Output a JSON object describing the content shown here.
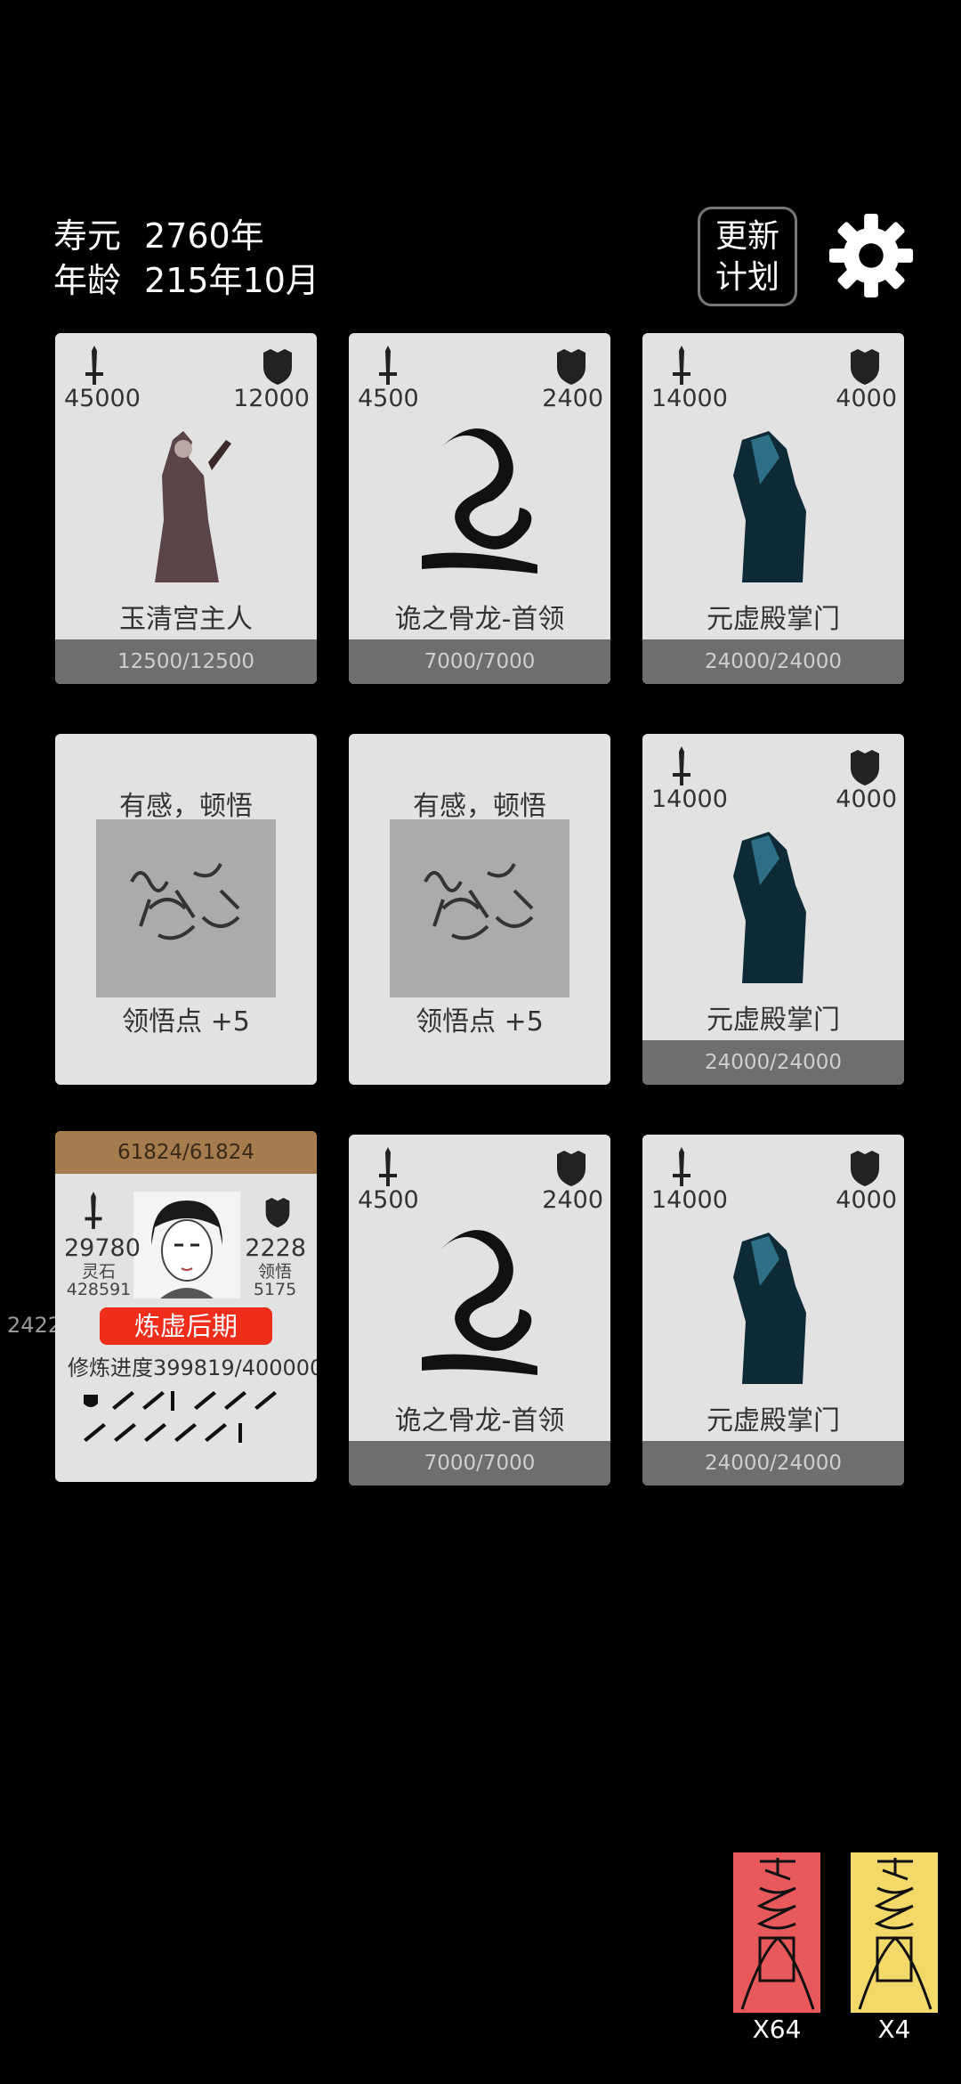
{
  "status": {
    "lifespan_label": "寿元",
    "lifespan_value": "2760年",
    "age_label": "年龄",
    "age_value": "215年10月"
  },
  "update_button": {
    "line1": "更新",
    "line2": "计划"
  },
  "icons": {
    "settings": "gear-icon",
    "attack": "sword-icon",
    "defense": "shield-icon"
  },
  "cards": [
    {
      "atk": "45000",
      "def": "12000",
      "name": "玉清宫主人",
      "hp": "12500/12500"
    },
    {
      "atk": "4500",
      "def": "2400",
      "name": "诡之骨龙-首领",
      "hp": "7000/7000"
    },
    {
      "atk": "14000",
      "def": "4000",
      "name": "元虚殿掌门",
      "hp": "24000/24000"
    },
    {
      "title": "有感，顿悟",
      "reward": "领悟点  +5"
    },
    {
      "title": "有感，顿悟",
      "reward": "领悟点  +5"
    },
    {
      "atk": "14000",
      "def": "4000",
      "name": "元虚殿掌门",
      "hp": "24000/24000"
    },
    {
      "atk": "4500",
      "def": "2400",
      "name": "诡之骨龙-首领",
      "hp": "7000/7000"
    },
    {
      "atk": "14000",
      "def": "4000",
      "name": "元虚殿掌门",
      "hp": "24000/24000"
    }
  ],
  "player": {
    "hp": "61824/61824",
    "atk": "29780",
    "def": "2228",
    "stone_label": "灵石",
    "stone_value": "428591",
    "insight_label": "领悟",
    "insight_value": "5175",
    "realm": "炼虚后期",
    "progress_label": "修炼进度",
    "progress_value": "399819/400000"
  },
  "side_number": "2422",
  "talismans": [
    {
      "count": "X64",
      "color": "#e8595b"
    },
    {
      "count": "X4",
      "color": "#f2d96a"
    }
  ]
}
